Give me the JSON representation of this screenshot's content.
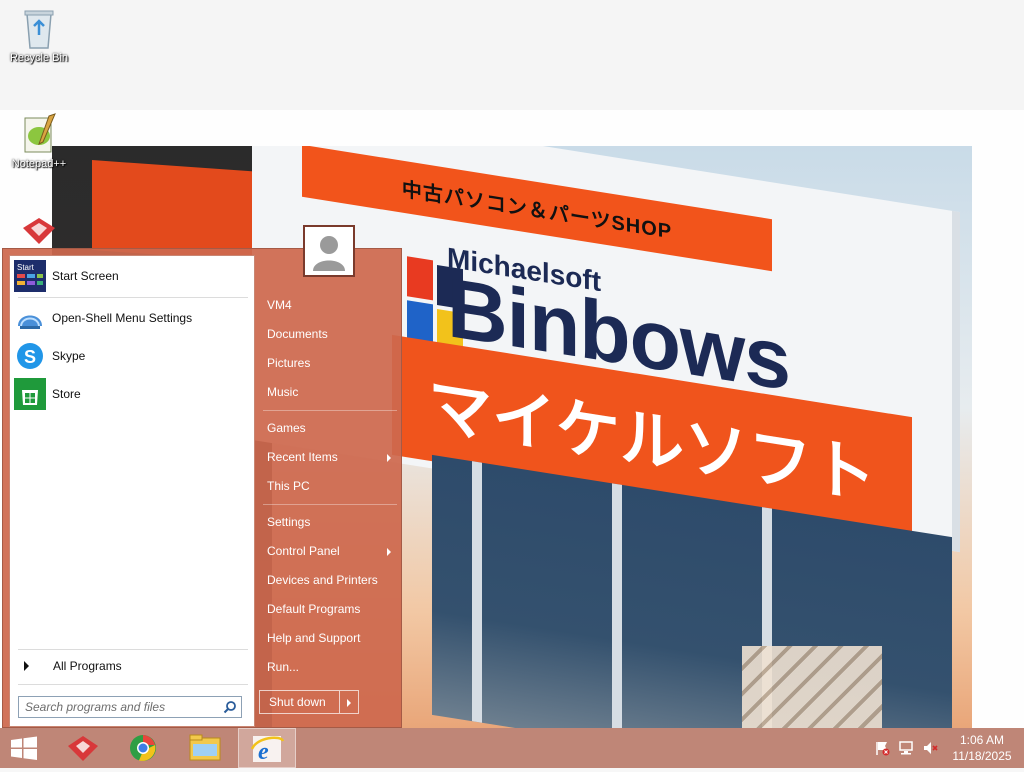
{
  "desktop": {
    "icons": [
      {
        "label": "Recycle Bin",
        "icon": "recycle-bin-icon"
      },
      {
        "label": "Notepad++",
        "icon": "notepad-plus-plus-icon"
      },
      {
        "label": "",
        "icon": "app-icon"
      }
    ],
    "wallpaper": {
      "sign_top_text": "中古パソコン＆パーツSHOP",
      "brand_small": "Michaelsoft",
      "brand_big": "Binbows",
      "katakana_text": "マイケルソフト"
    }
  },
  "start_menu": {
    "pinned": [
      {
        "label": "Start Screen",
        "icon": "start-screen-icon"
      },
      {
        "label": "Open-Shell Menu Settings",
        "icon": "open-shell-icon"
      },
      {
        "label": "Skype",
        "icon": "skype-icon"
      },
      {
        "label": "Store",
        "icon": "store-icon"
      }
    ],
    "start_screen_badge": "Start",
    "all_programs_label": "All Programs",
    "search_placeholder": "Search programs and files",
    "right_items": [
      {
        "label": "VM4"
      },
      {
        "label": "Documents"
      },
      {
        "label": "Pictures"
      },
      {
        "label": "Music"
      },
      {
        "label": "Games"
      },
      {
        "label": "Recent Items"
      },
      {
        "label": "This PC"
      },
      {
        "label": "Settings"
      },
      {
        "label": "Control Panel"
      },
      {
        "label": "Devices and Printers"
      },
      {
        "label": "Default Programs"
      },
      {
        "label": "Help and Support"
      },
      {
        "label": "Run..."
      }
    ],
    "shutdown_label": "Shut down"
  },
  "taskbar": {
    "apps": [
      "start-button",
      "app-icon",
      "chrome-icon",
      "file-explorer-icon",
      "internet-explorer-icon"
    ],
    "clock_time": "1:06 AM",
    "clock_date": "11/18/2025"
  },
  "colors": {
    "accent": "#cd684e",
    "taskbar": "#bc8070"
  }
}
